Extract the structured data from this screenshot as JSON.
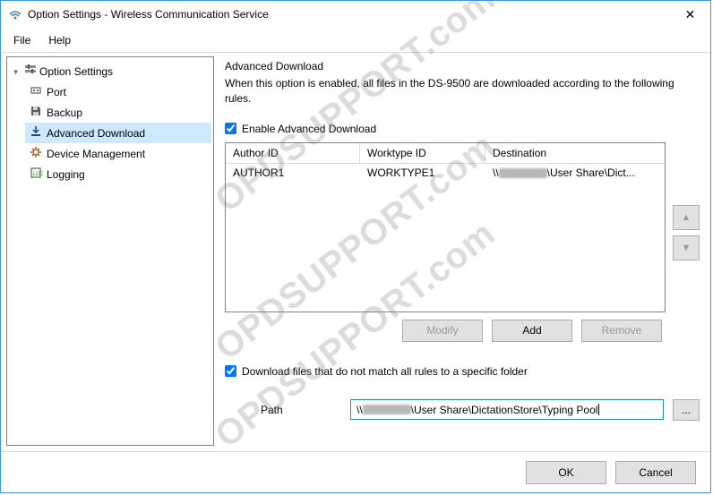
{
  "window": {
    "title": "Option Settings - Wireless Communication Service"
  },
  "menu": {
    "file": "File",
    "help": "Help"
  },
  "tree": {
    "root": "Option Settings",
    "items": [
      {
        "label": "Port"
      },
      {
        "label": "Backup"
      },
      {
        "label": "Advanced Download"
      },
      {
        "label": "Device Management"
      },
      {
        "label": "Logging"
      }
    ]
  },
  "content": {
    "title": "Advanced Download",
    "description": "When this option is enabled, all files in the DS-9500 are downloaded according to the following rules.",
    "enable_checkbox_label": "Enable Advanced Download",
    "enable_checked": true,
    "table": {
      "headers": {
        "author": "Author ID",
        "worktype": "Worktype ID",
        "destination": "Destination"
      },
      "rows": [
        {
          "author": "AUTHOR1",
          "worktype": "WORKTYPE1",
          "destination_prefix": "\\\\",
          "destination_suffix": "\\User Share\\Dict..."
        }
      ]
    },
    "buttons": {
      "modify": "Modify",
      "add": "Add",
      "remove": "Remove"
    },
    "fallback_checkbox_label": "Download files that do not match all rules to a specific folder",
    "fallback_checked": true,
    "path_label": "Path",
    "path_prefix": "\\\\",
    "path_suffix": "\\User Share\\DictationStore\\Typing Pool",
    "browse": "..."
  },
  "footer": {
    "ok": "OK",
    "cancel": "Cancel"
  },
  "watermark": "OPDSUPPORT.com"
}
